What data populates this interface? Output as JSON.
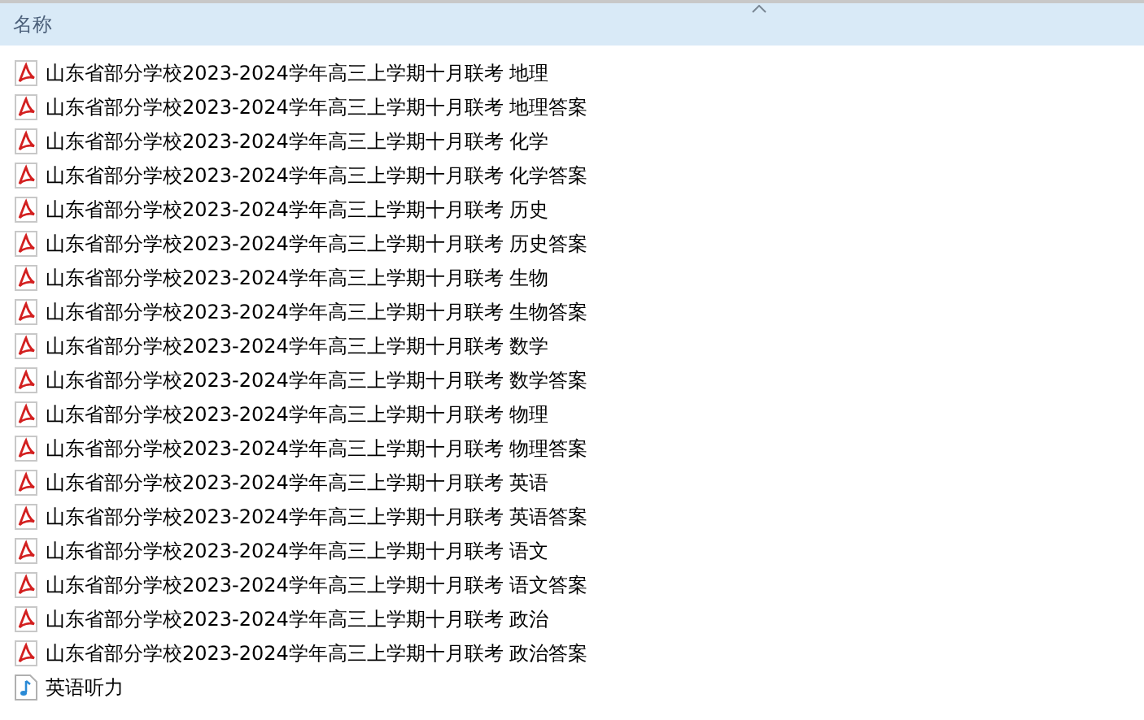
{
  "header": {
    "column": "名称",
    "sorted_ascending": true
  },
  "files": [
    {
      "name": "山东省部分学校2023-2024学年高三上学期十月联考 地理",
      "kind": "pdf"
    },
    {
      "name": "山东省部分学校2023-2024学年高三上学期十月联考 地理答案",
      "kind": "pdf"
    },
    {
      "name": "山东省部分学校2023-2024学年高三上学期十月联考 化学",
      "kind": "pdf"
    },
    {
      "name": "山东省部分学校2023-2024学年高三上学期十月联考 化学答案",
      "kind": "pdf"
    },
    {
      "name": "山东省部分学校2023-2024学年高三上学期十月联考 历史",
      "kind": "pdf"
    },
    {
      "name": "山东省部分学校2023-2024学年高三上学期十月联考 历史答案",
      "kind": "pdf"
    },
    {
      "name": "山东省部分学校2023-2024学年高三上学期十月联考 生物",
      "kind": "pdf"
    },
    {
      "name": "山东省部分学校2023-2024学年高三上学期十月联考 生物答案",
      "kind": "pdf"
    },
    {
      "name": "山东省部分学校2023-2024学年高三上学期十月联考 数学",
      "kind": "pdf"
    },
    {
      "name": "山东省部分学校2023-2024学年高三上学期十月联考 数学答案",
      "kind": "pdf"
    },
    {
      "name": "山东省部分学校2023-2024学年高三上学期十月联考 物理",
      "kind": "pdf"
    },
    {
      "name": "山东省部分学校2023-2024学年高三上学期十月联考 物理答案",
      "kind": "pdf"
    },
    {
      "name": "山东省部分学校2023-2024学年高三上学期十月联考 英语",
      "kind": "pdf"
    },
    {
      "name": "山东省部分学校2023-2024学年高三上学期十月联考 英语答案",
      "kind": "pdf"
    },
    {
      "name": "山东省部分学校2023-2024学年高三上学期十月联考 语文",
      "kind": "pdf"
    },
    {
      "name": "山东省部分学校2023-2024学年高三上学期十月联考 语文答案",
      "kind": "pdf"
    },
    {
      "name": "山东省部分学校2023-2024学年高三上学期十月联考 政治",
      "kind": "pdf"
    },
    {
      "name": "山东省部分学校2023-2024学年高三上学期十月联考 政治答案",
      "kind": "pdf"
    },
    {
      "name": "英语听力",
      "kind": "audio"
    }
  ]
}
